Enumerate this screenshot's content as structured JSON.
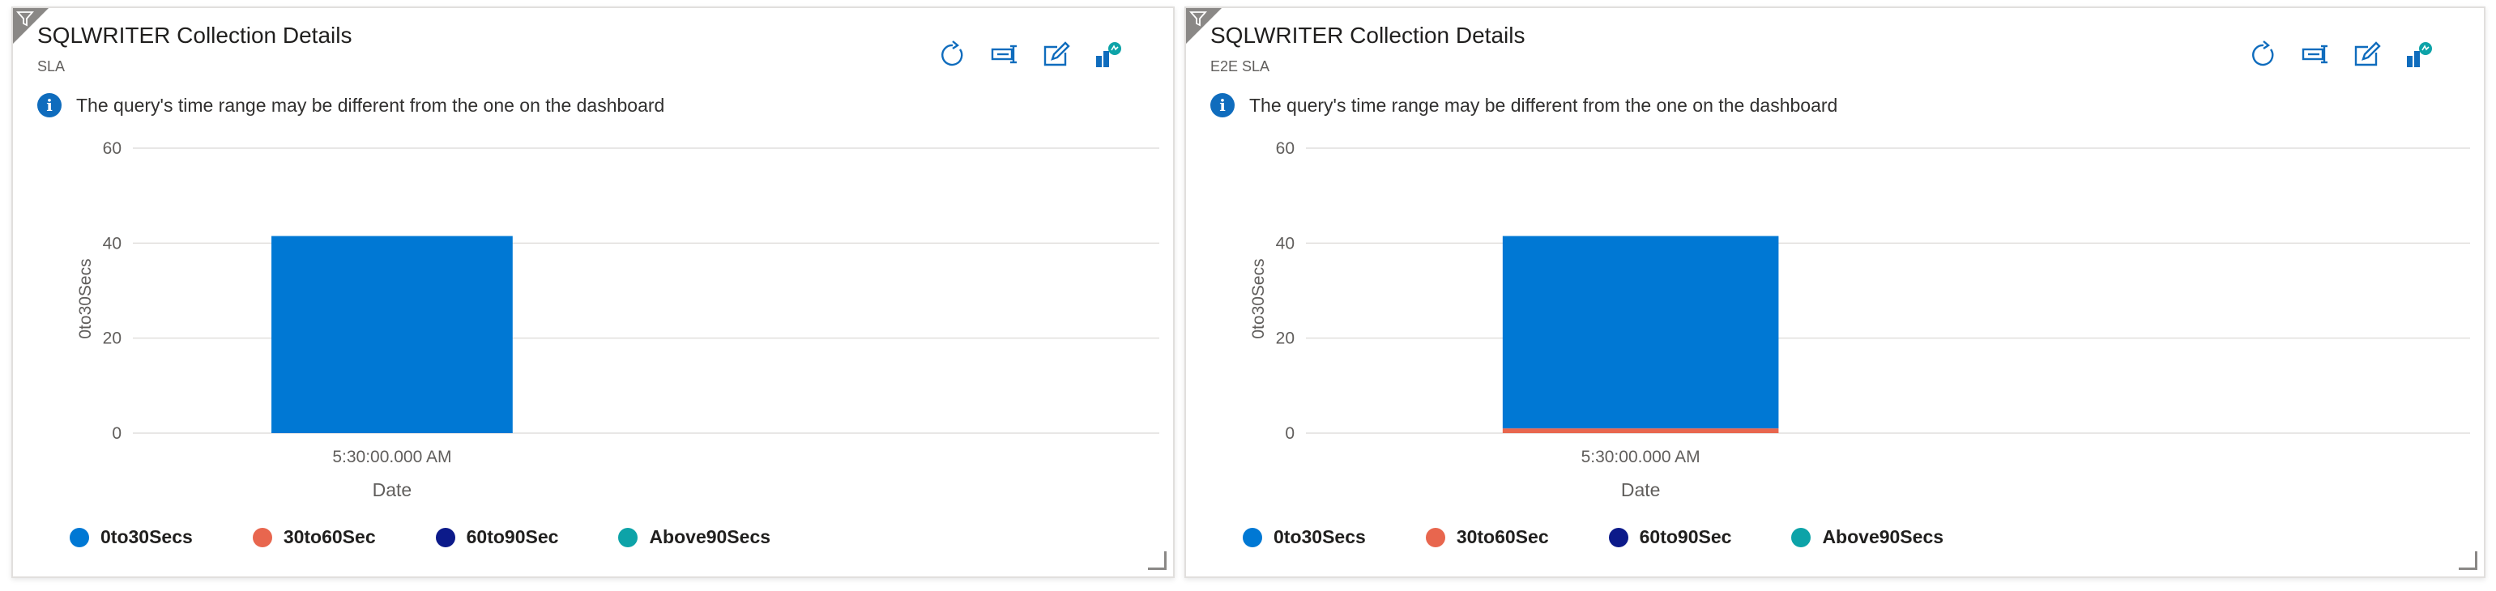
{
  "info_message": "The query's time range may be different from the one on the dashboard",
  "toolbar": {
    "refresh": "refresh-icon",
    "pin": "pin-icon",
    "edit": "edit-icon",
    "insights": "insights-icon"
  },
  "colors": {
    "0to30Secs": "#0078d4",
    "30to60Sec": "#e8664e",
    "60to90Sec": "#0c1a8a",
    "Above90Secs": "#0da3a8",
    "gridline": "#e1dfdd",
    "info": "#0f6cbd"
  },
  "panels": [
    {
      "title": "SQLWRITER Collection Details",
      "subtitle": "SLA",
      "legend": [
        {
          "label": "0to30Secs",
          "color": "#0078d4"
        },
        {
          "label": "30to60Sec",
          "color": "#e8664e"
        },
        {
          "label": "60to90Sec",
          "color": "#0c1a8a"
        },
        {
          "label": "Above90Secs",
          "color": "#0da3a8"
        }
      ]
    },
    {
      "title": "SQLWRITER Collection Details",
      "subtitle": "E2E SLA",
      "legend": [
        {
          "label": "0to30Secs",
          "color": "#0078d4"
        },
        {
          "label": "30to60Sec",
          "color": "#e8664e"
        },
        {
          "label": "60to90Sec",
          "color": "#0c1a8a"
        },
        {
          "label": "Above90Secs",
          "color": "#0da3a8"
        }
      ]
    }
  ],
  "chart_data": [
    {
      "type": "bar",
      "stacked": true,
      "categories": [
        "5:30:00.000 AM"
      ],
      "xlabel": "Date",
      "ylabel": "0to30Secs",
      "ylim": [
        0,
        60
      ],
      "yticks": [
        0,
        20,
        40,
        60
      ],
      "grid": true,
      "legend_position": "bottom",
      "series": [
        {
          "name": "0to30Secs",
          "values": [
            41.5
          ],
          "color": "#0078d4"
        },
        {
          "name": "30to60Sec",
          "values": [
            0
          ],
          "color": "#e8664e"
        },
        {
          "name": "60to90Sec",
          "values": [
            0
          ],
          "color": "#0c1a8a"
        },
        {
          "name": "Above90Secs",
          "values": [
            0
          ],
          "color": "#0da3a8"
        }
      ]
    },
    {
      "type": "bar",
      "stacked": true,
      "categories": [
        "5:30:00.000 AM"
      ],
      "xlabel": "Date",
      "ylabel": "0to30Secs",
      "ylim": [
        0,
        60
      ],
      "yticks": [
        0,
        20,
        40,
        60
      ],
      "grid": true,
      "legend_position": "bottom",
      "series": [
        {
          "name": "0to30Secs",
          "values": [
            40.5
          ],
          "color": "#0078d4"
        },
        {
          "name": "30to60Sec",
          "values": [
            1
          ],
          "color": "#e8664e"
        },
        {
          "name": "60to90Sec",
          "values": [
            0
          ],
          "color": "#0c1a8a"
        },
        {
          "name": "Above90Secs",
          "values": [
            0
          ],
          "color": "#0da3a8"
        }
      ]
    }
  ]
}
